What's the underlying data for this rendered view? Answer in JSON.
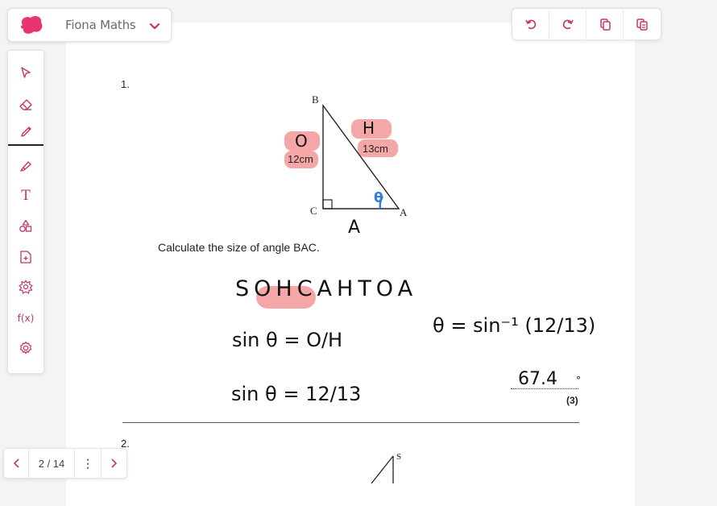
{
  "brand": {
    "name": "Fiona Maths",
    "logo_icon": "pink-blob-logo"
  },
  "toolbar": {
    "buttons": [
      "undo-icon",
      "redo-icon",
      "copy-icon",
      "paste-icon"
    ],
    "accent": "#c4356b"
  },
  "tools": {
    "items": [
      "select",
      "eraser",
      "pen",
      "highlighter",
      "text",
      "shapes",
      "add-image",
      "stamp",
      "formula",
      "settings"
    ],
    "active": "pen",
    "text_glyph": "T",
    "formula_glyph": "f(x)"
  },
  "pager": {
    "prev": "‹",
    "current": "2 / 14",
    "more": "⋮",
    "next": "›"
  },
  "document": {
    "q1_number": "1.",
    "vertex_b": "B",
    "vertex_c": "C",
    "vertex_a": "A",
    "side_opposite": "12cm",
    "side_hypotenuse": "13cm",
    "question_text": "Calculate the size of angle BAC.",
    "marks": "(3)",
    "q2_number": "2.",
    "q2_vertex_s": "S"
  },
  "annotations": {
    "label_o": "O",
    "label_h": "H",
    "label_a": "A",
    "angle_symbol": "θ",
    "mnemonic": "SOHCAHTOA",
    "line1": "sin θ = O/H",
    "line2": "sin θ = 12/13",
    "line3": "θ = sin⁻¹ (12/13)",
    "answer": "67.4",
    "degree": "°",
    "highlight_color": "#ef7878",
    "ink_blue": "#2b7de0"
  }
}
